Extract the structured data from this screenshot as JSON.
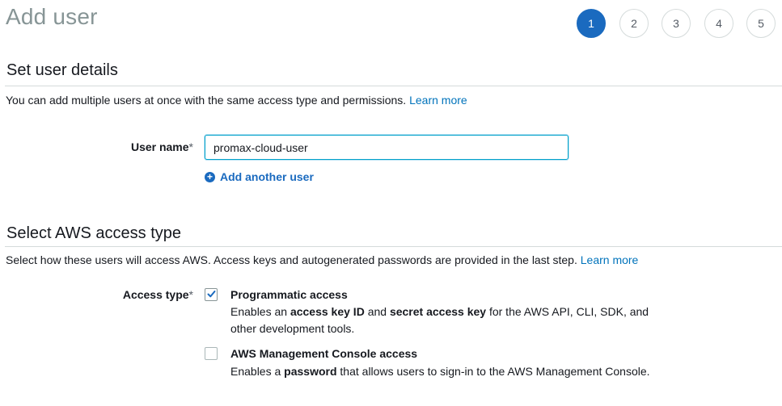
{
  "page": {
    "title": "Add user"
  },
  "steps": [
    "1",
    "2",
    "3",
    "4",
    "5"
  ],
  "active_step": "1",
  "user_details": {
    "heading": "Set user details",
    "description": "You can add multiple users at once with the same access type and permissions.",
    "learn_more": "Learn more",
    "user_name_label": "User name",
    "required_marker": "*",
    "user_name_value": "promax-cloud-user",
    "add_another_label": "Add another user",
    "add_another_icon": "plus-circle-icon"
  },
  "access": {
    "heading": "Select AWS access type",
    "description": "Select how these users will access AWS. Access keys and autogenerated passwords are provided in the last step.",
    "learn_more": "Learn more",
    "label": "Access type",
    "required_marker": "*",
    "options": [
      {
        "title": "Programmatic access",
        "checked": true,
        "desc_parts": [
          "Enables an ",
          "access key ID",
          " and ",
          "secret access key",
          " for the AWS API, CLI, SDK, and other development tools."
        ]
      },
      {
        "title": "AWS Management Console access",
        "checked": false,
        "desc_parts": [
          "Enables a ",
          "password",
          " that allows users to sign-in to the AWS Management Console."
        ]
      }
    ]
  },
  "colors": {
    "accent": "#1a6abf",
    "link": "#0073bb",
    "title_grey": "#879596"
  }
}
